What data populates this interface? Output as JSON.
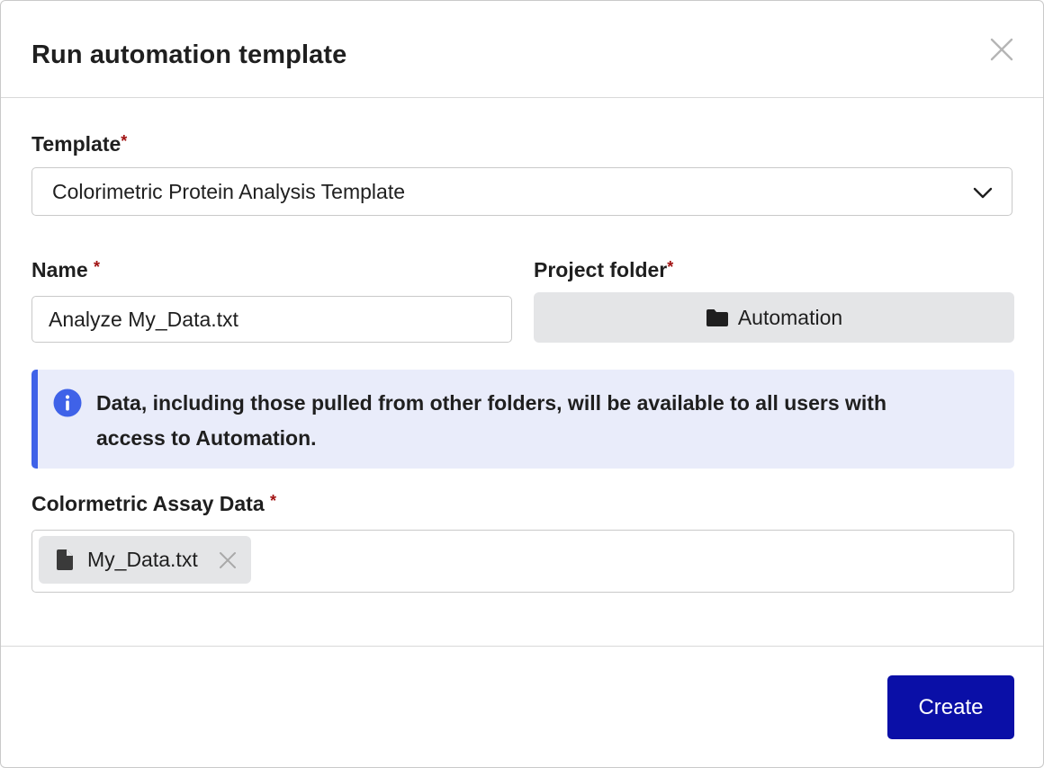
{
  "dialog": {
    "title": "Run automation template"
  },
  "form": {
    "required_mark": "*",
    "template": {
      "label": "Template",
      "selected": "Colorimetric Protein Analysis Template"
    },
    "name": {
      "label": "Name",
      "value": "Analyze My_Data.txt"
    },
    "project_folder": {
      "label": "Project folder",
      "value": "Automation"
    },
    "info": {
      "text": "Data, including those pulled from other folders, will be available to all users with access to Automation."
    },
    "assay_data": {
      "label": "Colormetric Assay Data",
      "files": [
        "My_Data.txt"
      ]
    }
  },
  "footer": {
    "create_label": "Create"
  },
  "colors": {
    "primary": "#0a0fa7",
    "info_accent": "#3f62e8",
    "info_bg": "#e9ecfa",
    "required": "#a11212"
  },
  "icons": {
    "close": "close-icon",
    "chevron": "chevron-down-icon",
    "folder": "folder-icon",
    "info": "info-icon",
    "file": "file-icon",
    "remove": "remove-icon"
  }
}
